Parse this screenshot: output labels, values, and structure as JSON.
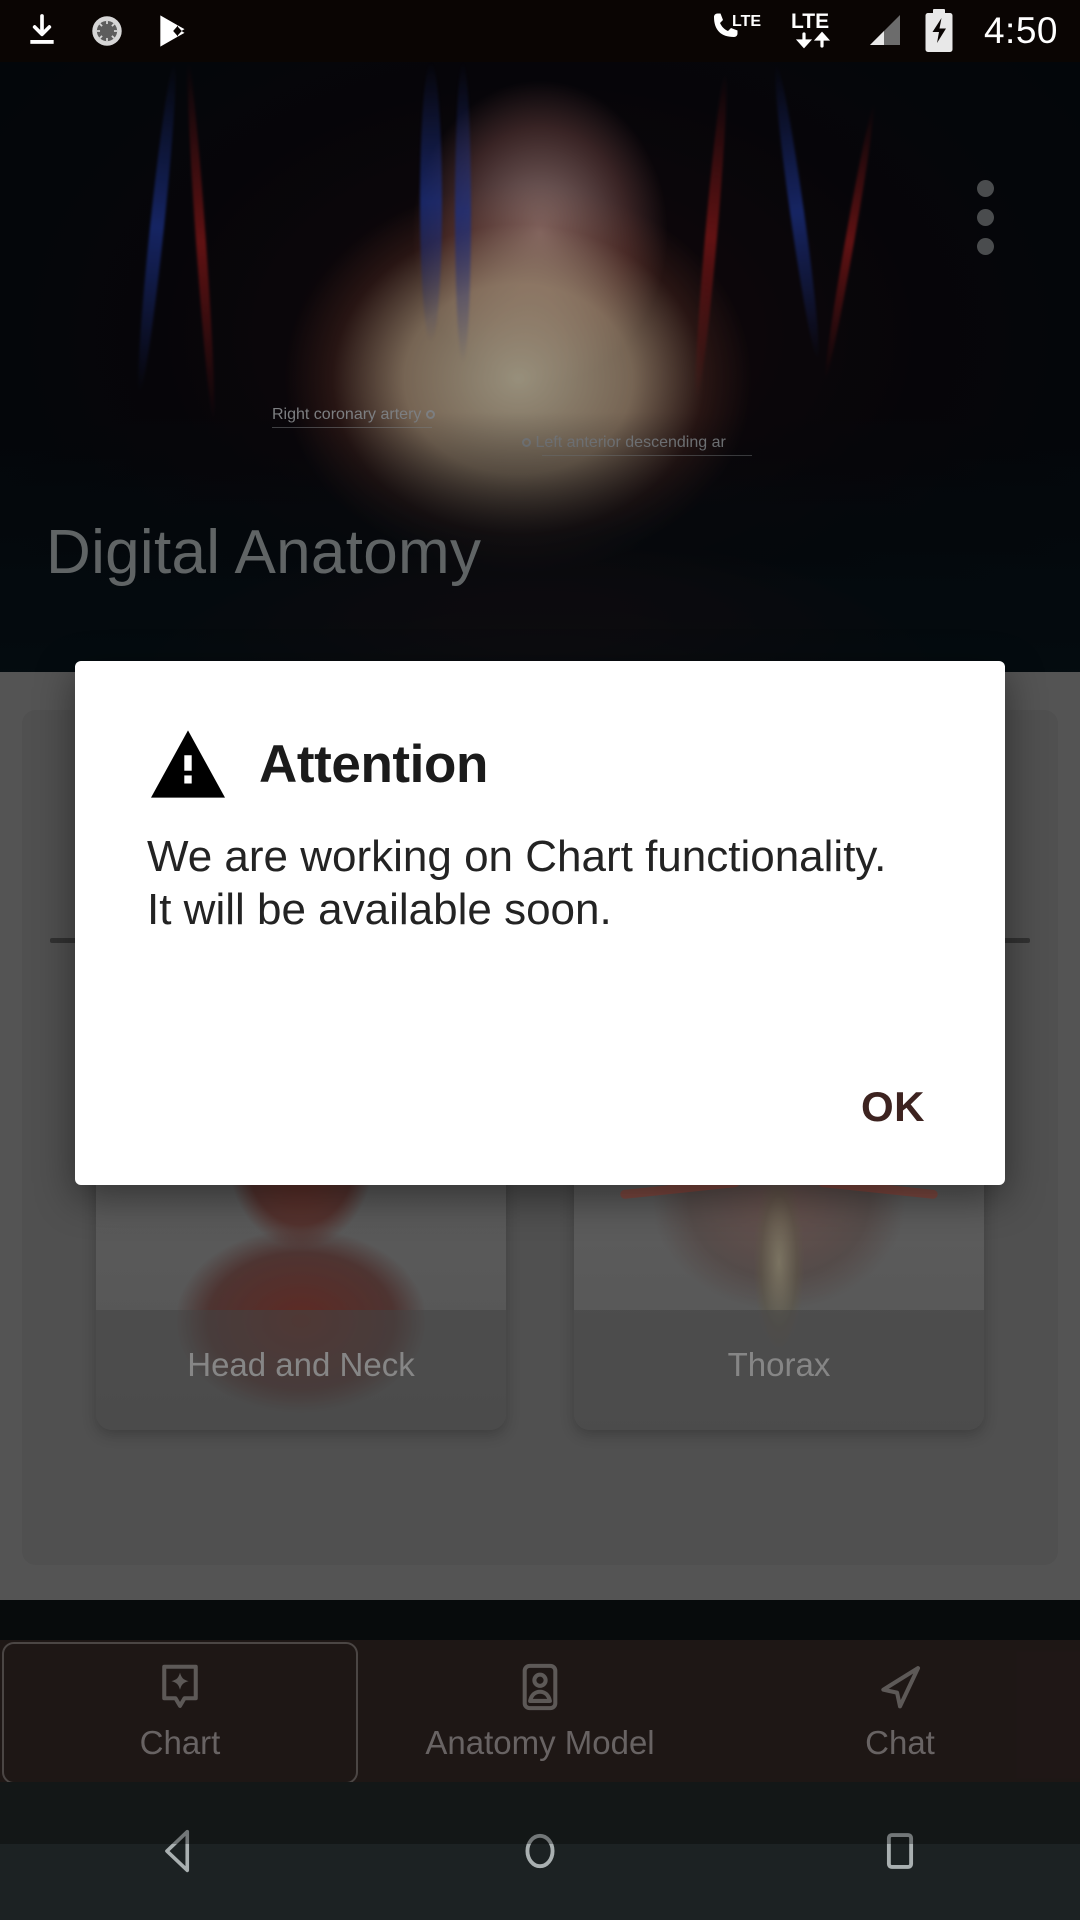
{
  "status_bar": {
    "icons": [
      "download-icon",
      "loading-spinner-icon",
      "play-store-icon"
    ],
    "signal_left_label": "LTE",
    "signal_right_label": "LTE",
    "clock": "4:50",
    "battery_state": "charging"
  },
  "hero": {
    "title": "Digital Anatomy",
    "overflow_menu": "overflow-menu",
    "annotations": [
      {
        "label": "Right coronary artery"
      },
      {
        "label": "Left anterior descending ar"
      }
    ]
  },
  "cards": [
    {
      "label": "Head and Neck"
    },
    {
      "label": "Thorax"
    }
  ],
  "dialog": {
    "icon": "warning-triangle-icon",
    "title": "Attention",
    "message": "We are working on Chart functionality. It will be available soon.",
    "ok_label": "OK",
    "ok_color": "#3d2320",
    "background": "#ffffff"
  },
  "bottom_nav": {
    "selected": "Chart",
    "items": [
      {
        "label": "Chart",
        "icon": "chart-sparkle-icon",
        "selected": true
      },
      {
        "label": "Anatomy Model",
        "icon": "person-card-icon",
        "selected": false
      },
      {
        "label": "Chat",
        "icon": "send-arrow-icon",
        "selected": false
      }
    ],
    "background": "#2d2220",
    "label_color": "#9a9392"
  },
  "system_nav": {
    "back": "back-triangle-icon",
    "home": "home-circle-icon",
    "recents": "recents-square-icon",
    "background": "#1c2223"
  }
}
